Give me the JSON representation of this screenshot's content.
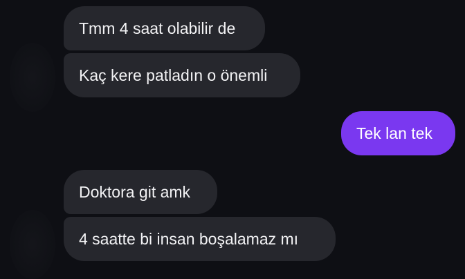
{
  "conversation": {
    "colors": {
      "background": "#0e0f14",
      "incoming_bubble": "#26272d",
      "outgoing_bubble": "#7a38f0",
      "text": "#f2f2f4"
    },
    "messages": [
      {
        "direction": "incoming",
        "text": "Tmm 4 saat olabilir de"
      },
      {
        "direction": "incoming",
        "text": "Kaç kere patladın o önemli"
      },
      {
        "direction": "outgoing",
        "text": "Tek lan tek"
      },
      {
        "direction": "incoming",
        "text": "Doktora git amk"
      },
      {
        "direction": "incoming",
        "text": "4 saatte bi insan boşalamaz mı"
      }
    ]
  }
}
